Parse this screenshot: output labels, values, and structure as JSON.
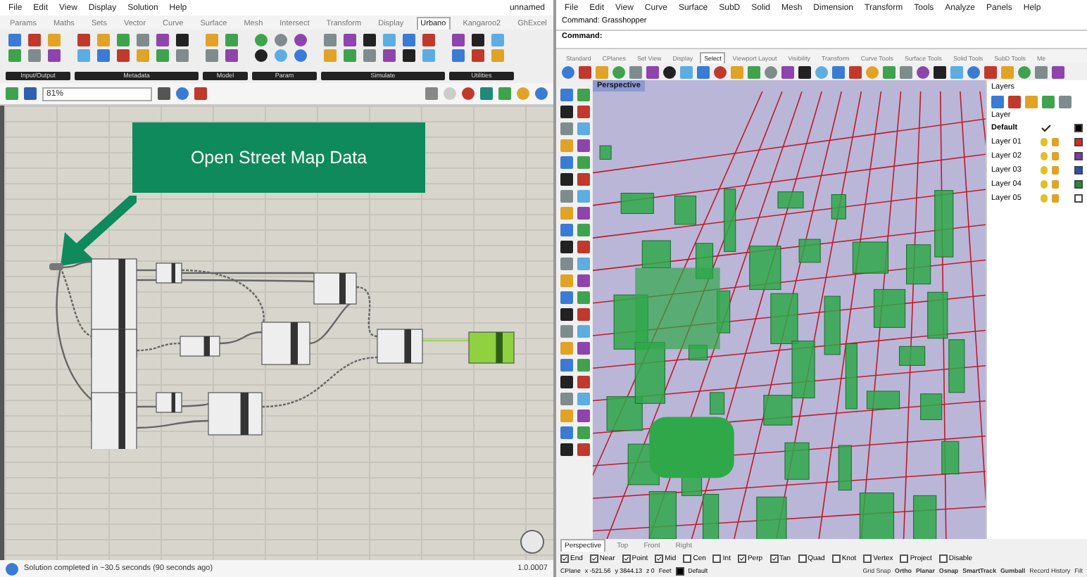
{
  "grasshopper": {
    "menu": [
      "File",
      "Edit",
      "View",
      "Display",
      "Solution",
      "Help"
    ],
    "document": "unnamed",
    "tabs": [
      {
        "label": "Params",
        "selected": false
      },
      {
        "label": "Maths",
        "selected": false
      },
      {
        "label": "Sets",
        "selected": false
      },
      {
        "label": "Vector",
        "selected": false
      },
      {
        "label": "Curve",
        "selected": false
      },
      {
        "label": "Surface",
        "selected": false
      },
      {
        "label": "Mesh",
        "selected": false
      },
      {
        "label": "Intersect",
        "selected": false
      },
      {
        "label": "Transform",
        "selected": false
      },
      {
        "label": "Display",
        "selected": false
      },
      {
        "label": "Urbano",
        "selected": true
      },
      {
        "label": "Kangaroo2",
        "selected": false
      },
      {
        "label": "GhExcel",
        "selected": false
      }
    ],
    "ribbon_groups": [
      {
        "label": "Input/Output"
      },
      {
        "label": "Metadata"
      },
      {
        "label": "Model"
      },
      {
        "label": "Param"
      },
      {
        "label": "Simulate"
      },
      {
        "label": "Utilities"
      }
    ],
    "zoom": "81%",
    "callout": "Open Street Map Data",
    "status": "Solution completed in ~30.5 seconds (90 seconds ago)",
    "version": "1.0.0007"
  },
  "rhino": {
    "menu": [
      "File",
      "Edit",
      "View",
      "Curve",
      "Surface",
      "SubD",
      "Solid",
      "Mesh",
      "Dimension",
      "Transform",
      "Tools",
      "Analyze",
      "Panels",
      "Help"
    ],
    "command_history": "Command: Grasshopper",
    "command_prompt": "Command:",
    "tabs": [
      {
        "label": "Standard",
        "selected": false
      },
      {
        "label": "CPlanes",
        "selected": false
      },
      {
        "label": "Set View",
        "selected": false
      },
      {
        "label": "Display",
        "selected": false
      },
      {
        "label": "Select",
        "selected": true
      },
      {
        "label": "Viewport Layout",
        "selected": false
      },
      {
        "label": "Visibility",
        "selected": false
      },
      {
        "label": "Transform",
        "selected": false
      },
      {
        "label": "Curve Tools",
        "selected": false
      },
      {
        "label": "Surface Tools",
        "selected": false
      },
      {
        "label": "Solid Tools",
        "selected": false
      },
      {
        "label": "SubD Tools",
        "selected": false
      },
      {
        "label": "Me",
        "selected": false
      }
    ],
    "viewport_title": "Perspective",
    "layers": {
      "title": "Layers",
      "header": "Layer",
      "items": [
        {
          "name": "Default",
          "current": true,
          "color": "#000000"
        },
        {
          "name": "Layer 01",
          "current": false,
          "color": "#d42a2a"
        },
        {
          "name": "Layer 02",
          "current": false,
          "color": "#7a3fa0"
        },
        {
          "name": "Layer 03",
          "current": false,
          "color": "#2f4fb0"
        },
        {
          "name": "Layer 04",
          "current": false,
          "color": "#2a8a3a"
        },
        {
          "name": "Layer 05",
          "current": false,
          "color": "#ffffff"
        }
      ]
    },
    "view_tabs": [
      {
        "label": "Perspective",
        "selected": true
      },
      {
        "label": "Top",
        "selected": false
      },
      {
        "label": "Front",
        "selected": false
      },
      {
        "label": "Right",
        "selected": false
      }
    ],
    "osnaps": [
      {
        "label": "End",
        "checked": true
      },
      {
        "label": "Near",
        "checked": true
      },
      {
        "label": "Point",
        "checked": true
      },
      {
        "label": "Mid",
        "checked": true
      },
      {
        "label": "Cen",
        "checked": false
      },
      {
        "label": "Int",
        "checked": false
      },
      {
        "label": "Perp",
        "checked": true
      },
      {
        "label": "Tan",
        "checked": true
      },
      {
        "label": "Quad",
        "checked": false
      },
      {
        "label": "Knot",
        "checked": false
      },
      {
        "label": "Vertex",
        "checked": false
      },
      {
        "label": "Project",
        "checked": false
      },
      {
        "label": "Disable",
        "checked": false
      }
    ],
    "status": {
      "cplane": "CPlane",
      "x": "x -521.56",
      "y": "y 3844.13",
      "z": "z 0",
      "units": "Feet",
      "layer": "Default",
      "toggles": [
        {
          "label": "Grid Snap",
          "on": false
        },
        {
          "label": "Ortho",
          "on": true
        },
        {
          "label": "Planar",
          "on": true
        },
        {
          "label": "Osnap",
          "on": true
        },
        {
          "label": "SmartTrack",
          "on": true
        },
        {
          "label": "Gumball",
          "on": true
        },
        {
          "label": "Record History",
          "on": false
        },
        {
          "label": "Filt",
          "on": false
        }
      ]
    }
  }
}
